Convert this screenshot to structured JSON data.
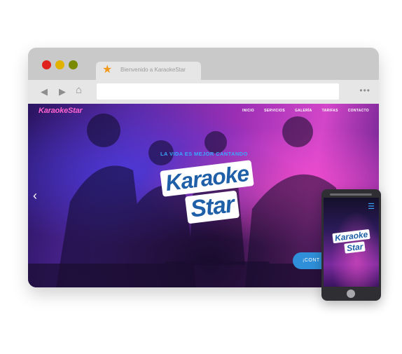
{
  "browser": {
    "window_controls": [
      {
        "name": "close",
        "color": "#e0201b"
      },
      {
        "name": "minimize",
        "color": "#e2b200"
      },
      {
        "name": "maximize",
        "color": "#7a8a00"
      }
    ],
    "tab": {
      "title": "Bienvenido a KaraokeStar",
      "icon": "star-icon",
      "icon_color": "#f29a1c"
    },
    "toolbar": {
      "back_icon": "chevron-left-icon",
      "forward_icon": "chevron-right-icon",
      "home_icon": "home-icon",
      "address_value": "",
      "menu_icon": "more-dots-icon"
    }
  },
  "site": {
    "logo_text": "KaraokeStar",
    "logo_color": "#ff63cf",
    "nav": [
      "INICIO",
      "SERVICIOS",
      "GALERÍA",
      "TARIFAS",
      "CONTACTO"
    ],
    "hero": {
      "tagline": "LA VIDA ES MEJOR CANTANDO",
      "logo_line1": "Karaoke",
      "logo_line2": "Star",
      "prev_icon": "chevron-left-icon",
      "cta_label": "¡CONT"
    },
    "accent_color": "#2f8fd8"
  },
  "phone": {
    "menu_icon": "hamburger-icon",
    "logo_line1": "Karaoke",
    "logo_line2": "Star"
  }
}
